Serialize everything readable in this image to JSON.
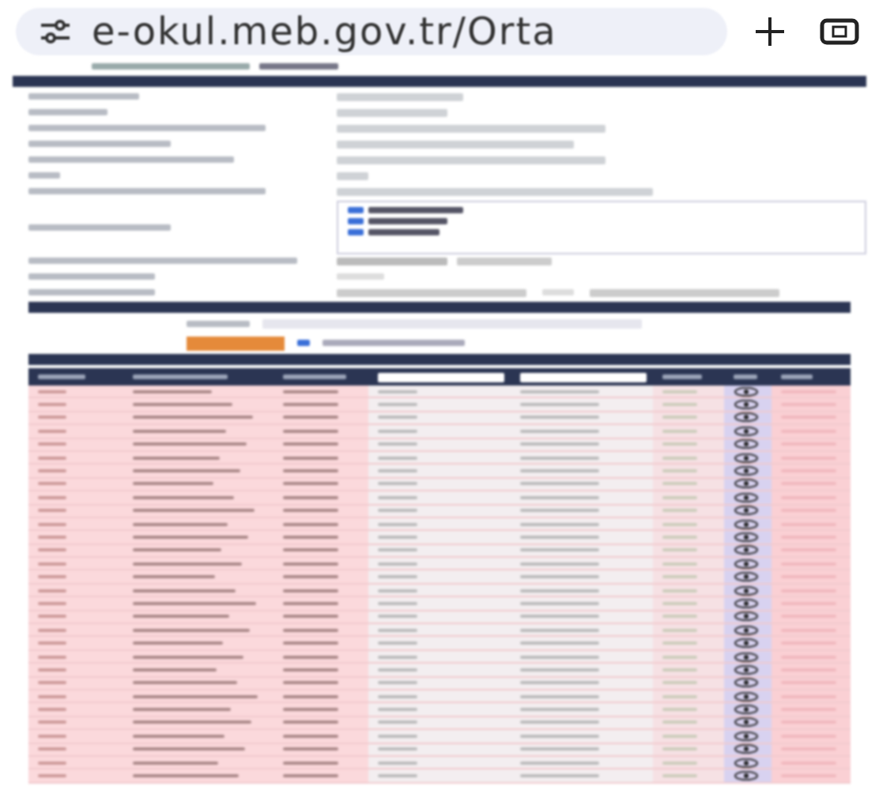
{
  "browser": {
    "url": "e-okul.meb.gov.tr/Orta"
  }
}
